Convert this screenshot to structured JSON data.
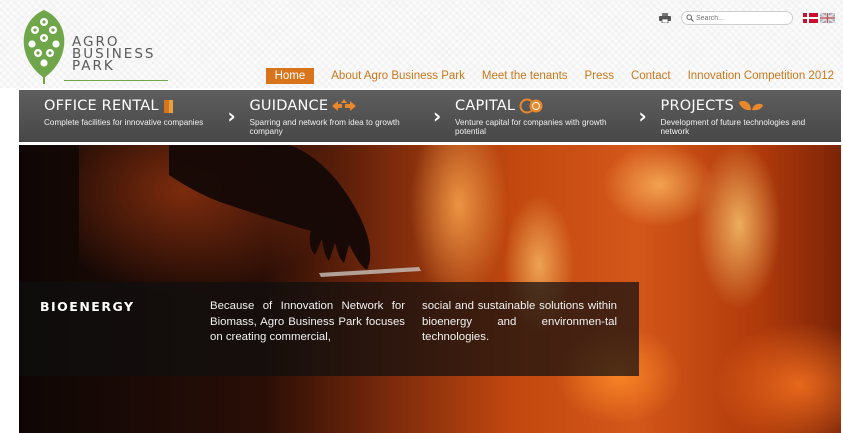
{
  "logo": {
    "line1": "AGRO",
    "line2": "BUSINESS",
    "line3": "PARK",
    "icon": "leaf-logo-icon"
  },
  "utility": {
    "print_icon": "print-icon",
    "search_placeholder": "Search...",
    "search_icon": "search-icon",
    "flags": [
      "danish-flag-icon",
      "uk-flag-icon"
    ]
  },
  "nav": {
    "items": [
      {
        "label": "Home",
        "active": true
      },
      {
        "label": "About Agro Business Park",
        "active": false
      },
      {
        "label": "Meet the tenants",
        "active": false
      },
      {
        "label": "Press",
        "active": false
      },
      {
        "label": "Contact",
        "active": false
      },
      {
        "label": "Innovation Competition 2012",
        "active": false
      }
    ]
  },
  "services": [
    {
      "title": "OFFICE RENTAL",
      "icon": "door-icon",
      "desc": "Complete facilities for innovative companies"
    },
    {
      "title": "GUIDANCE",
      "icon": "arrows-icon",
      "desc": "Sparring and network from idea to growth company"
    },
    {
      "title": "CAPITAL",
      "icon": "coins-icon",
      "desc": "Venture capital for companies with growth potential"
    },
    {
      "title": "PROJECTS",
      "icon": "leaves-icon",
      "desc": "Development of future technologies and network"
    }
  ],
  "hero": {
    "heading": "BIOENERGY",
    "col1": "Because of Innovation Network for Biomass, Agro Business Park focuses on creating commercial,",
    "col2": "social and sustainable solutions within bioenergy and environmen-tal technologies."
  },
  "colors": {
    "accent_orange": "#d8751c",
    "nav_link": "#c8781b",
    "logo_green": "#6fa64a",
    "service_bar": "#4f4f4f"
  }
}
